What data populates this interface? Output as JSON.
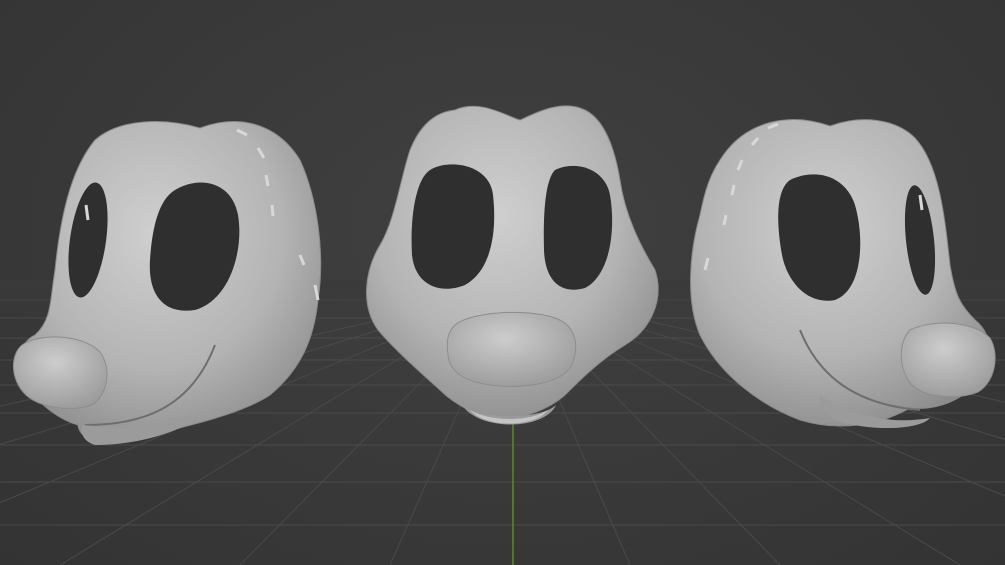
{
  "viewport": {
    "background_color": "#3a3a3a",
    "grid_color": "#4a4a4a",
    "axis_y_color": "#5a8a2a",
    "model_color": "#b9b9b9",
    "model_shadow_color": "#7d7d7d",
    "hole_color": "#2f2f2f"
  },
  "models": [
    {
      "name": "mask-left-three-quarter-view"
    },
    {
      "name": "mask-front-view"
    },
    {
      "name": "mask-right-three-quarter-view"
    }
  ]
}
